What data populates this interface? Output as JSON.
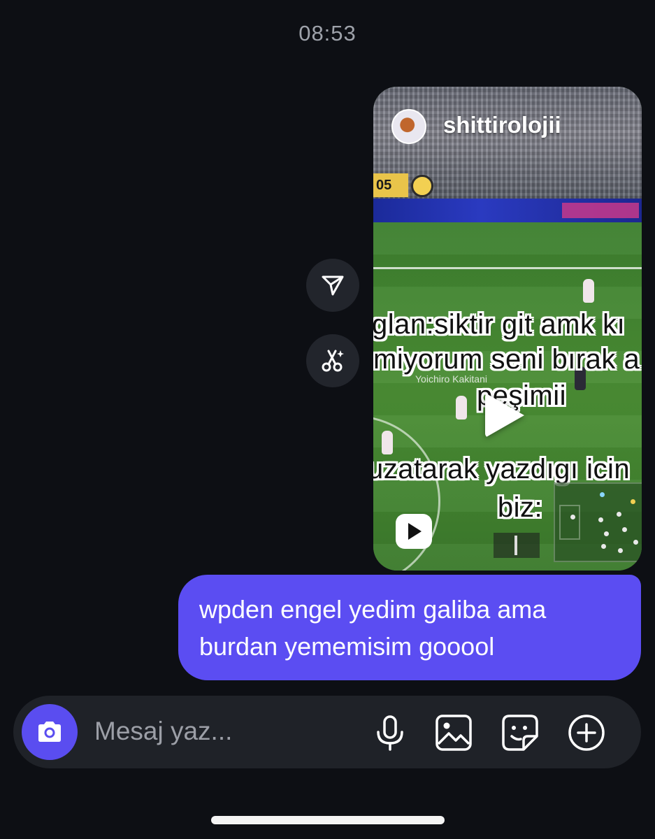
{
  "status": {
    "time": "08:53"
  },
  "reel": {
    "username": "shittirolojii",
    "score_badge": "05",
    "player_label": "Yoichiro Kakitani",
    "caption_lines": [
      "glan:siktir git amk kı",
      "miyorum seni bırak a",
      "peşimii",
      "uzatarak yazdıgı icin",
      "biz:"
    ],
    "play_icon": "play-icon",
    "reels_icon": "reels-icon"
  },
  "side_actions": [
    {
      "icon": "send-icon"
    },
    {
      "icon": "ai-scissors-icon"
    }
  ],
  "message": {
    "lines": [
      "wpden engel yedim galiba ama",
      "burdan yememisim gooool"
    ]
  },
  "composer": {
    "placeholder": "Mesaj yaz...",
    "camera_icon": "camera-icon",
    "tools": [
      "microphone-icon",
      "image-icon",
      "sticker-icon",
      "add-icon"
    ]
  },
  "colors": {
    "background": "#0d0f14",
    "bubble": "#5b4df2",
    "composer": "#1f2228",
    "accent": "#5a4df0"
  }
}
